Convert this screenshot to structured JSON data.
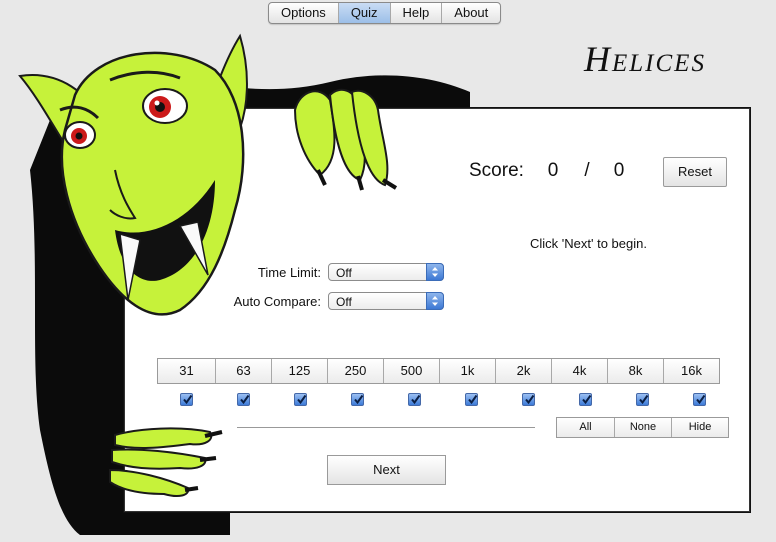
{
  "tabs": [
    {
      "label": "Options",
      "active": false
    },
    {
      "label": "Quiz",
      "active": true
    },
    {
      "label": "Help",
      "active": false
    },
    {
      "label": "About",
      "active": false
    }
  ],
  "app_title": "Helices",
  "score": {
    "label": "Score:",
    "correct": "0",
    "separator": "/",
    "total": "0",
    "reset_label": "Reset"
  },
  "prompt": "Click 'Next' to begin.",
  "time_limit": {
    "label": "Time Limit:",
    "value": "Off"
  },
  "auto_compare": {
    "label": "Auto Compare:",
    "value": "Off"
  },
  "frequencies": [
    "31",
    "63",
    "125",
    "250",
    "500",
    "1k",
    "2k",
    "4k",
    "8k",
    "16k"
  ],
  "frequency_checked": [
    true,
    true,
    true,
    true,
    true,
    true,
    true,
    true,
    true,
    true
  ],
  "selection_buttons": {
    "all": "All",
    "none": "None",
    "hide": "Hide"
  },
  "next_label": "Next",
  "colors": {
    "accent": "#3d7bd8",
    "monster_skin": "#c6f23a",
    "eye": "#cc1a1a"
  }
}
